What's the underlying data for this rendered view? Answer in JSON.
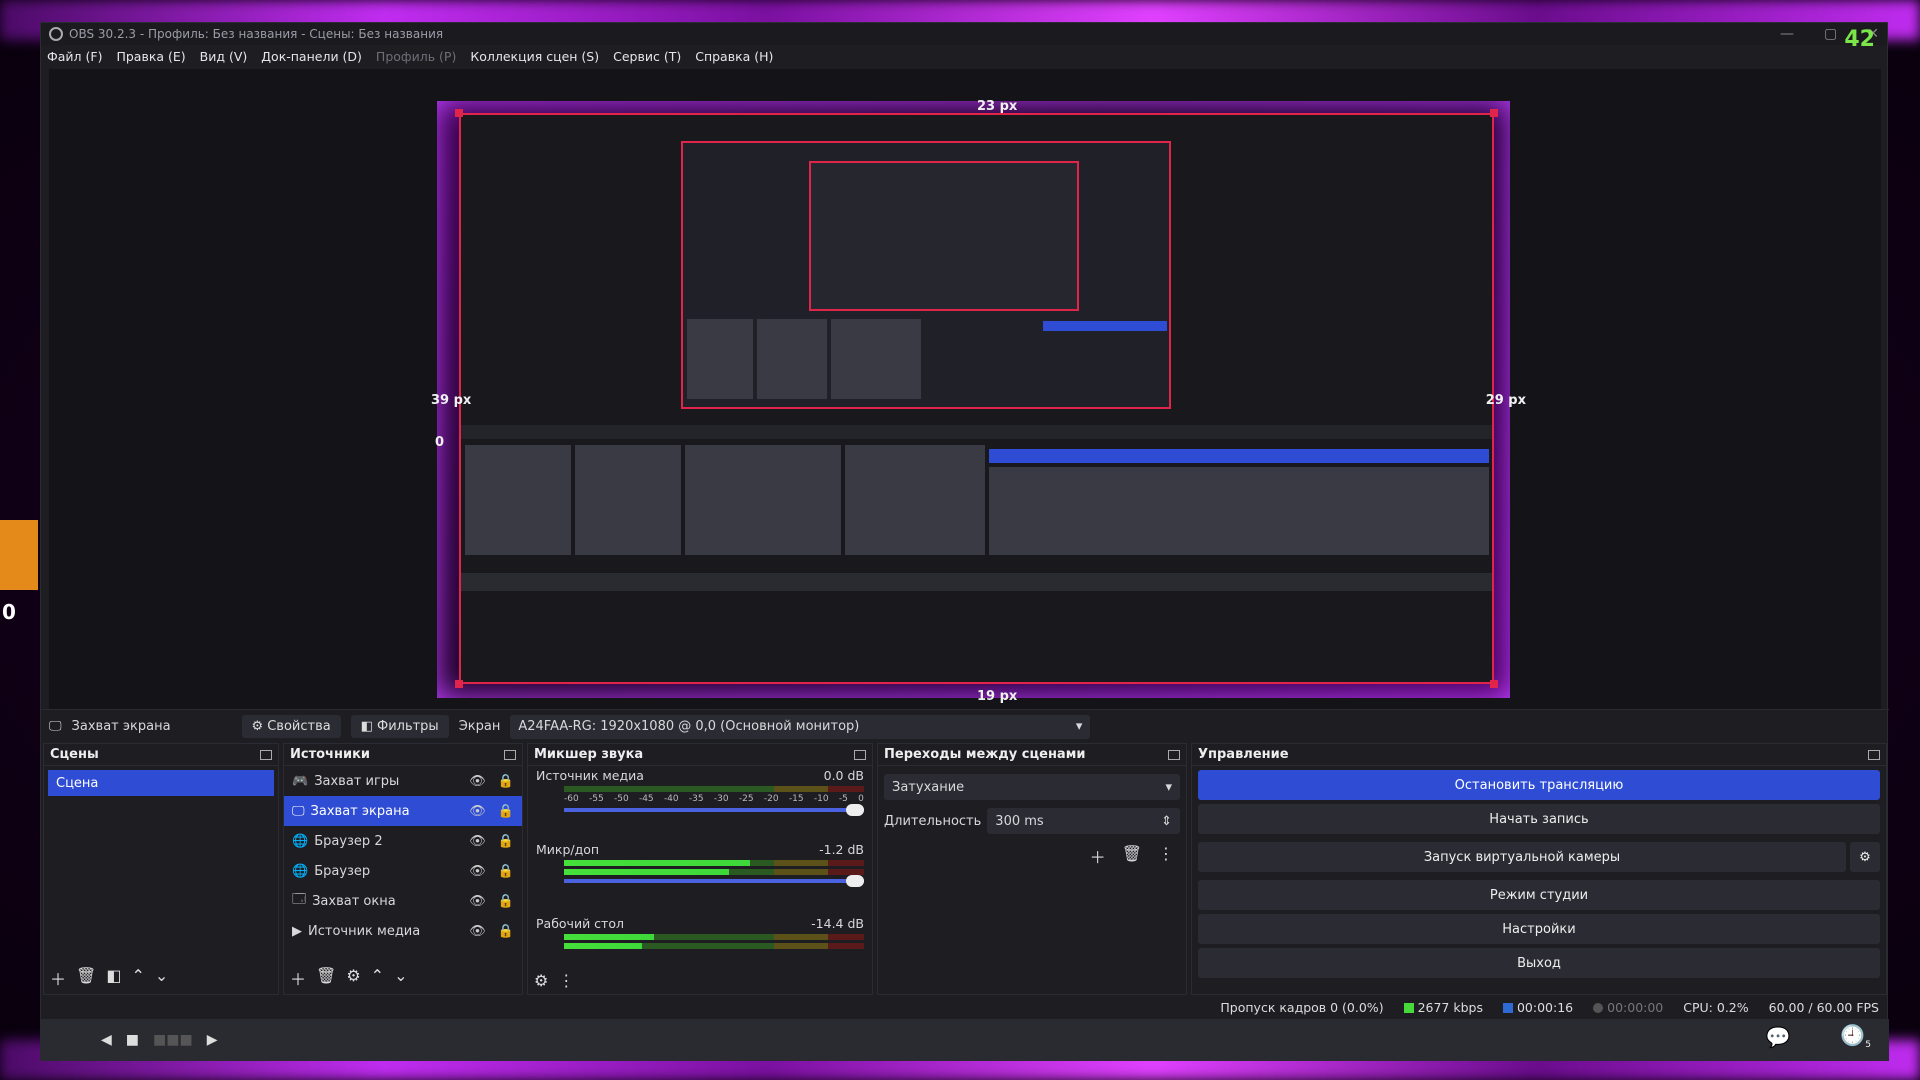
{
  "window": {
    "title": "OBS 30.2.3 - Профиль: Без названия - Сцены: Без названия",
    "fps_overlay": "42",
    "controls": [
      "—",
      "▢",
      "✕"
    ]
  },
  "menu": [
    {
      "label": "Файл (F)"
    },
    {
      "label": "Правка (E)"
    },
    {
      "label": "Вид (V)"
    },
    {
      "label": "Док-панели (D)"
    },
    {
      "label": "Профиль (P)"
    },
    {
      "label": "Коллекция сцен (S)"
    },
    {
      "label": "Сервис (T)"
    },
    {
      "label": "Справка (H)"
    }
  ],
  "preview": {
    "labels": {
      "top": "23 px",
      "left": "39 px",
      "right": "29 px",
      "bottom": "19 px",
      "left_zero": "0"
    },
    "outer_zero": "0"
  },
  "source_bar": {
    "source_name": "Захват экрана",
    "properties": "Свойства",
    "filters": "Фильтры",
    "screen_label": "Экран",
    "display": "A24FAA-RG: 1920x1080 @ 0,0 (Основной монитор)"
  },
  "scenes": {
    "title": "Сцены",
    "items": [
      "Сцена"
    ]
  },
  "sources": {
    "title": "Источники",
    "items": [
      {
        "label": "Захват игры",
        "icon": "gamepad-icon"
      },
      {
        "label": "Захват экрана",
        "icon": "monitor-icon"
      },
      {
        "label": "Браузер 2",
        "icon": "globe-icon"
      },
      {
        "label": "Браузер",
        "icon": "globe-icon"
      },
      {
        "label": "Захват окна",
        "icon": "window-icon"
      },
      {
        "label": "Источник медиа",
        "icon": "play-icon"
      }
    ]
  },
  "mixer": {
    "title": "Микшер звука",
    "scale": [
      "-60",
      "-55",
      "-50",
      "-45",
      "-40",
      "-35",
      "-30",
      "-25",
      "-20",
      "-15",
      "-10",
      "-5",
      "0"
    ],
    "channels": [
      {
        "name": "Источник медиа",
        "db": "0.0 dB",
        "level": 0.0
      },
      {
        "name": "Микр/доп",
        "db": "-1.2 dB",
        "level": 0.62
      },
      {
        "name": "Рабочий стол",
        "db": "-14.4 dB",
        "level": 0.3
      }
    ]
  },
  "transitions": {
    "title": "Переходы между сценами",
    "selected": "Затухание",
    "duration_label": "Длительность",
    "duration": "300 ms"
  },
  "controls": {
    "title": "Управление",
    "stop_stream": "Остановить трансляцию",
    "start_record": "Начать запись",
    "virtual_cam": "Запуск виртуальной камеры",
    "studio_mode": "Режим студии",
    "settings": "Настройки",
    "exit": "Выход"
  },
  "status": {
    "dropped": "Пропуск кадров 0 (0.0%)",
    "bitrate": "2677 kbps",
    "stream_time": "00:00:16",
    "record_time": "00:00:00",
    "cpu": "CPU: 0.2%",
    "fps": "60.00 / 60.00 FPS"
  },
  "corner": {
    "history_count": "5"
  },
  "colors": {
    "accent": "#2f4dd4",
    "bounds": "#e0244a",
    "fps": "#7be64a"
  }
}
